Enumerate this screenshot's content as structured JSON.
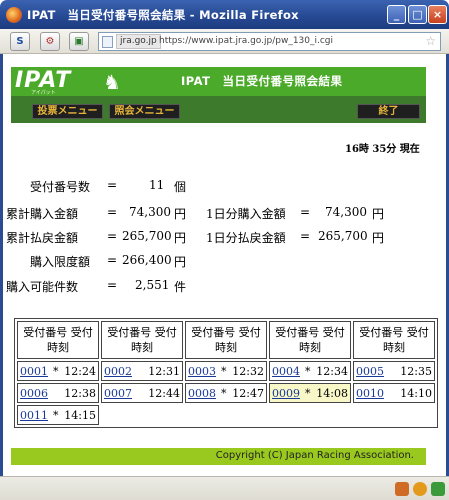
{
  "window": {
    "title": "IPAT　当日受付番号照会結果 - Mozilla Firefox",
    "controls": [
      "_",
      "□",
      "×"
    ]
  },
  "toolbar": {
    "domain": "jra.go.jp",
    "url": "https://www.ipat.jra.go.jp/pw_130_i.cgi"
  },
  "page": {
    "logo": "IPAT",
    "logo_sub": "アイパット",
    "header_title": "IPAT　当日受付番号照会結果",
    "menu": {
      "bet_menu": "投票メニュー",
      "inquiry_menu": "照会メニュー",
      "exit": "終了"
    },
    "timestamp": "16時 35分 現在",
    "summary": [
      {
        "label": "受付番号数",
        "eq": "=",
        "value": "11",
        "unit": "個"
      },
      {
        "label": "累計購入金額",
        "eq": "=",
        "value": "74,300",
        "unit": "円",
        "label2": "1日分購入金額",
        "eq2": "=",
        "value2": "74,300",
        "unit2": "円"
      },
      {
        "label": "累計払戻金額",
        "eq": "=",
        "value": "265,700",
        "unit": "円",
        "label2": "1日分払戻金額",
        "eq2": "=",
        "value2": "265,700",
        "unit2": "円"
      },
      {
        "label": "購入限度額",
        "eq": "=",
        "value": "266,400",
        "unit": "円"
      },
      {
        "label": "購入可能件数",
        "eq": "=",
        "value": "2,551",
        "unit": "件"
      }
    ],
    "table": {
      "headers": [
        "受付番号 受付時刻",
        "受付番号 受付時刻",
        "受付番号 受付時刻",
        "受付番号 受付時刻",
        "受付番号 受付時刻"
      ],
      "rows": [
        [
          {
            "no": "0001",
            "mark": "*",
            "time": "12:24"
          },
          {
            "no": "0002",
            "mark": "",
            "time": "12:31"
          },
          {
            "no": "0003",
            "mark": "*",
            "time": "12:32"
          },
          {
            "no": "0004",
            "mark": "*",
            "time": "12:34"
          },
          {
            "no": "0005",
            "mark": "",
            "time": "12:35"
          }
        ],
        [
          {
            "no": "0006",
            "mark": "",
            "time": "12:38"
          },
          {
            "no": "0007",
            "mark": "",
            "time": "12:44"
          },
          {
            "no": "0008",
            "mark": "*",
            "time": "12:47"
          },
          {
            "no": "0009",
            "mark": "*",
            "time": "14:08"
          },
          {
            "no": "0010",
            "mark": "",
            "time": "14:10"
          }
        ],
        [
          {
            "no": "0011",
            "mark": "*",
            "time": "14:15"
          }
        ]
      ]
    },
    "footer": "Copyright (C) Japan Racing Association."
  }
}
